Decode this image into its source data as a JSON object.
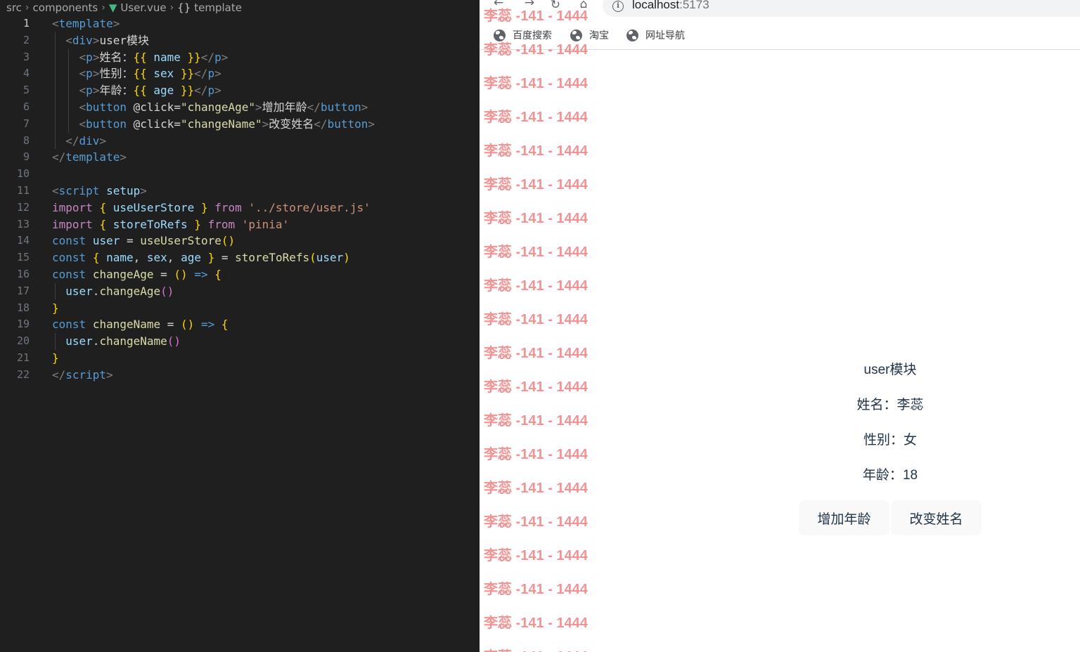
{
  "editor": {
    "breadcrumb": [
      "src",
      "components",
      "User.vue",
      "template"
    ],
    "lines": [
      {
        "n": "1",
        "tokens": [
          [
            "<",
            "t-punc"
          ],
          [
            "template",
            "t-tag"
          ],
          [
            ">",
            "t-punc"
          ]
        ]
      },
      {
        "n": "2",
        "tokens": [
          [
            "  ",
            ""
          ],
          [
            "<",
            "t-punc"
          ],
          [
            "div",
            "t-tag"
          ],
          [
            ">",
            "t-punc"
          ],
          [
            "user模块",
            "t-text"
          ]
        ]
      },
      {
        "n": "3",
        "tokens": [
          [
            "    ",
            ""
          ],
          [
            "<",
            "t-punc"
          ],
          [
            "p",
            "t-tag"
          ],
          [
            ">",
            "t-punc"
          ],
          [
            "姓名：",
            "t-text"
          ],
          [
            "{{",
            "t-br1"
          ],
          [
            " name ",
            "t-var"
          ],
          [
            "}}",
            "t-br1"
          ],
          [
            "</",
            "t-punc"
          ],
          [
            "p",
            "t-tag"
          ],
          [
            ">",
            "t-punc"
          ]
        ]
      },
      {
        "n": "4",
        "tokens": [
          [
            "    ",
            ""
          ],
          [
            "<",
            "t-punc"
          ],
          [
            "p",
            "t-tag"
          ],
          [
            ">",
            "t-punc"
          ],
          [
            "性别：",
            "t-text"
          ],
          [
            "{{",
            "t-br1"
          ],
          [
            " sex ",
            "t-var"
          ],
          [
            "}}",
            "t-br1"
          ],
          [
            "</",
            "t-punc"
          ],
          [
            "p",
            "t-tag"
          ],
          [
            ">",
            "t-punc"
          ]
        ]
      },
      {
        "n": "5",
        "tokens": [
          [
            "    ",
            ""
          ],
          [
            "<",
            "t-punc"
          ],
          [
            "p",
            "t-tag"
          ],
          [
            ">",
            "t-punc"
          ],
          [
            "年龄：",
            "t-text"
          ],
          [
            "{{",
            "t-br1"
          ],
          [
            " age ",
            "t-var"
          ],
          [
            "}}",
            "t-br1"
          ],
          [
            "</",
            "t-punc"
          ],
          [
            "p",
            "t-tag"
          ],
          [
            ">",
            "t-punc"
          ]
        ]
      },
      {
        "n": "6",
        "tokens": [
          [
            "    ",
            ""
          ],
          [
            "<",
            "t-punc"
          ],
          [
            "button",
            "t-tag"
          ],
          [
            " ",
            ""
          ],
          [
            "@click",
            "t-ev"
          ],
          [
            "=",
            "t-text"
          ],
          [
            "\"changeAge\"",
            "t-strval"
          ],
          [
            ">",
            "t-punc"
          ],
          [
            "增加年龄",
            "t-text"
          ],
          [
            "</",
            "t-punc"
          ],
          [
            "button",
            "t-tag"
          ],
          [
            ">",
            "t-punc"
          ]
        ]
      },
      {
        "n": "7",
        "tokens": [
          [
            "    ",
            ""
          ],
          [
            "<",
            "t-punc"
          ],
          [
            "button",
            "t-tag"
          ],
          [
            " ",
            ""
          ],
          [
            "@click",
            "t-ev"
          ],
          [
            "=",
            "t-text"
          ],
          [
            "\"changeName\"",
            "t-strval"
          ],
          [
            ">",
            "t-punc"
          ],
          [
            "改变姓名",
            "t-text"
          ],
          [
            "</",
            "t-punc"
          ],
          [
            "button",
            "t-tag"
          ],
          [
            ">",
            "t-punc"
          ]
        ]
      },
      {
        "n": "8",
        "tokens": [
          [
            "  ",
            ""
          ],
          [
            "</",
            "t-punc"
          ],
          [
            "div",
            "t-tag"
          ],
          [
            ">",
            "t-punc"
          ]
        ]
      },
      {
        "n": "9",
        "tokens": [
          [
            "</",
            "t-punc"
          ],
          [
            "template",
            "t-tag"
          ],
          [
            ">",
            "t-punc"
          ]
        ]
      },
      {
        "n": "10",
        "tokens": []
      },
      {
        "n": "11",
        "tokens": [
          [
            "<",
            "t-punc"
          ],
          [
            "script",
            "t-tag"
          ],
          [
            " ",
            ""
          ],
          [
            "setup",
            "t-attr"
          ],
          [
            ">",
            "t-punc"
          ]
        ]
      },
      {
        "n": "12",
        "tokens": [
          [
            "import",
            "t-kw2"
          ],
          [
            " ",
            ""
          ],
          [
            "{",
            "t-br1"
          ],
          [
            " useUserStore ",
            "t-var"
          ],
          [
            "}",
            "t-br1"
          ],
          [
            " ",
            ""
          ],
          [
            "from",
            "t-kw2"
          ],
          [
            " ",
            ""
          ],
          [
            "'../store/user.js'",
            "t-str"
          ]
        ]
      },
      {
        "n": "13",
        "tokens": [
          [
            "import",
            "t-kw2"
          ],
          [
            " ",
            ""
          ],
          [
            "{",
            "t-br1"
          ],
          [
            " storeToRefs ",
            "t-var"
          ],
          [
            "}",
            "t-br1"
          ],
          [
            " ",
            ""
          ],
          [
            "from",
            "t-kw2"
          ],
          [
            " ",
            ""
          ],
          [
            "'pinia'",
            "t-str"
          ]
        ]
      },
      {
        "n": "14",
        "tokens": [
          [
            "const",
            "t-kw"
          ],
          [
            " ",
            ""
          ],
          [
            "user",
            "t-var"
          ],
          [
            " = ",
            "t-text"
          ],
          [
            "useUserStore",
            "t-fn"
          ],
          [
            "()",
            "t-br1"
          ]
        ]
      },
      {
        "n": "15",
        "tokens": [
          [
            "const",
            "t-kw"
          ],
          [
            " ",
            ""
          ],
          [
            "{",
            "t-br1"
          ],
          [
            " name",
            "t-var"
          ],
          [
            ", ",
            "t-text"
          ],
          [
            "sex",
            "t-var"
          ],
          [
            ", ",
            "t-text"
          ],
          [
            "age",
            "t-var"
          ],
          [
            " ",
            ""
          ],
          [
            "}",
            "t-br1"
          ],
          [
            " = ",
            "t-text"
          ],
          [
            "storeToRefs",
            "t-fn"
          ],
          [
            "(",
            "t-br1"
          ],
          [
            "user",
            "t-var"
          ],
          [
            ")",
            "t-br1"
          ]
        ]
      },
      {
        "n": "16",
        "tokens": [
          [
            "const",
            "t-kw"
          ],
          [
            " ",
            ""
          ],
          [
            "changeAge",
            "t-fn"
          ],
          [
            " = ",
            "t-text"
          ],
          [
            "()",
            "t-br1"
          ],
          [
            " ",
            ""
          ],
          [
            "=>",
            "t-kw"
          ],
          [
            " ",
            ""
          ],
          [
            "{",
            "t-br1"
          ]
        ]
      },
      {
        "n": "17",
        "tokens": [
          [
            "  ",
            ""
          ],
          [
            "user",
            "t-var"
          ],
          [
            ".",
            "t-text"
          ],
          [
            "changeAge",
            "t-fn"
          ],
          [
            "()",
            "t-br2"
          ]
        ]
      },
      {
        "n": "18",
        "tokens": [
          [
            "}",
            "t-br1"
          ]
        ]
      },
      {
        "n": "19",
        "tokens": [
          [
            "const",
            "t-kw"
          ],
          [
            " ",
            ""
          ],
          [
            "changeName",
            "t-fn"
          ],
          [
            " = ",
            "t-text"
          ],
          [
            "()",
            "t-br1"
          ],
          [
            " ",
            ""
          ],
          [
            "=>",
            "t-kw"
          ],
          [
            " ",
            ""
          ],
          [
            "{",
            "t-br1"
          ]
        ]
      },
      {
        "n": "20",
        "tokens": [
          [
            "  ",
            ""
          ],
          [
            "user",
            "t-var"
          ],
          [
            ".",
            "t-text"
          ],
          [
            "changeName",
            "t-fn"
          ],
          [
            "()",
            "t-br2"
          ]
        ]
      },
      {
        "n": "21",
        "tokens": [
          [
            "}",
            "t-br1"
          ]
        ]
      },
      {
        "n": "22",
        "tokens": [
          [
            "</",
            "t-punc"
          ],
          [
            "script",
            "t-tag"
          ],
          [
            ">",
            "t-punc"
          ]
        ]
      }
    ]
  },
  "browser": {
    "url_host": "localhost",
    "url_port": ":5173",
    "bookmarks": [
      "百度搜索",
      "淘宝",
      "网址导航"
    ],
    "log_text": "李蕊 -141 - 1444",
    "log_count": 20,
    "user_module": {
      "heading": "user模块",
      "name_label": "姓名：",
      "name_value": "李蕊",
      "sex_label": "性别：",
      "sex_value": "女",
      "age_label": "年龄：",
      "age_value": "18",
      "btn_change_age": "增加年龄",
      "btn_change_name": "改变姓名"
    }
  }
}
